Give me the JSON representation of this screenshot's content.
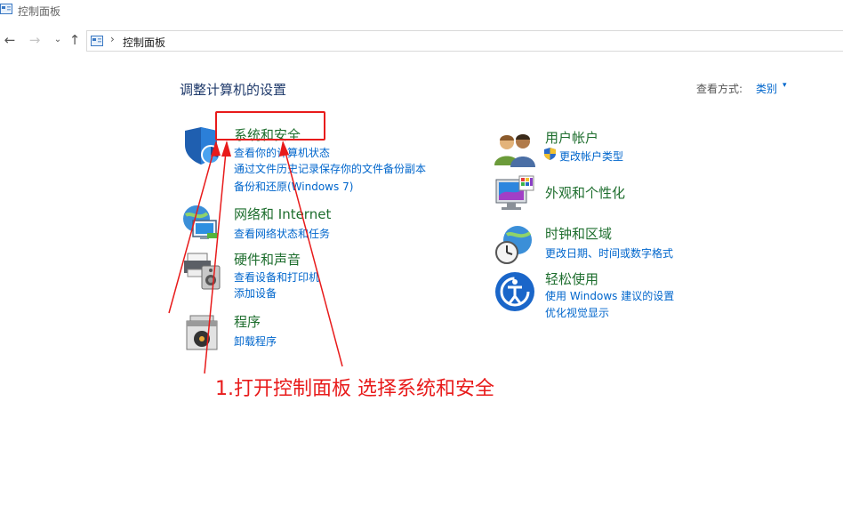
{
  "window": {
    "title": "控制面板"
  },
  "address": {
    "crumb": "控制面板",
    "separator": "›"
  },
  "nav": {
    "back": "←",
    "forward": "→",
    "recent": "⌄",
    "up": "↑"
  },
  "main": {
    "heading": "调整计算机的设置",
    "view_by_label": "查看方式:",
    "view_by_value": "类别",
    "view_by_arrow": "▾"
  },
  "categories_left": [
    {
      "title": "系统和安全",
      "icon": "shield-icon",
      "links": [
        "查看你的计算机状态",
        "通过文件历史记录保存你的文件备份副本",
        "备份和还原(Windows 7)"
      ]
    },
    {
      "title": "网络和 Internet",
      "icon": "network-globe-icon",
      "links": [
        "查看网络状态和任务"
      ]
    },
    {
      "title": "硬件和声音",
      "icon": "printer-speaker-icon",
      "links": [
        "查看设备和打印机",
        "添加设备"
      ]
    },
    {
      "title": "程序",
      "icon": "programs-disc-icon",
      "links": [
        "卸载程序"
      ]
    }
  ],
  "categories_right": [
    {
      "title": "用户帐户",
      "icon": "users-icon",
      "links": [
        "更改帐户类型"
      ]
    },
    {
      "title": "外观和个性化",
      "icon": "monitor-palette-icon",
      "links": []
    },
    {
      "title": "时钟和区域",
      "icon": "globe-clock-icon",
      "links": [
        "更改日期、时间或数字格式"
      ]
    },
    {
      "title": "轻松使用",
      "icon": "ease-of-access-icon",
      "links": [
        "使用 Windows 建议的设置",
        "优化视觉显示"
      ]
    }
  ],
  "annotation": {
    "text": "1.打开控制面板 选择系统和安全"
  },
  "colors": {
    "category_title": "#1e6e2e",
    "link": "#0066cc",
    "annotation": "#e81b1b",
    "heading": "#1f3a6b"
  }
}
